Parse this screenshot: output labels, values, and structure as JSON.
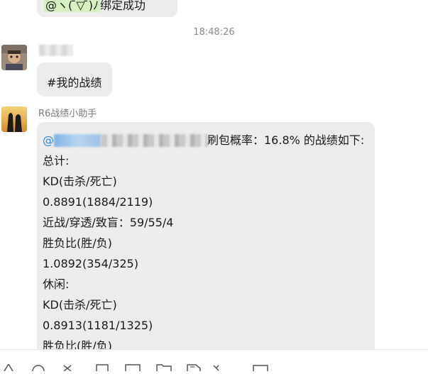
{
  "messages": {
    "top_partial": {
      "mention_prefix": "@ヽ( ̄▽ ̄)ﾉ",
      "text": "绑定成功"
    },
    "timestamp": "18:48:26",
    "user_message": {
      "text": "#我的战绩"
    },
    "bot_message": {
      "sender_name": "R6战绩小助手",
      "mention_at": "@",
      "lines": [
        "刷包概率：16.8% 的战绩如下:",
        "总计:",
        "KD(击杀/死亡)",
        "0.8891(1884/2119)",
        "近战/穿透/致盲：59/55/4",
        "胜负比(胜/负)",
        "1.0892(354/325)",
        "休闲:",
        "KD(击杀/死亡)",
        "0.8913(1181/1325)",
        "胜负比(胜/负)"
      ]
    }
  },
  "toolbar": {
    "icons": [
      "font-icon",
      "emoji-icon",
      "scissors-icon",
      "screenshot-icon",
      "image-icon",
      "folder-icon",
      "file-icon",
      "document-icon",
      "voice-icon",
      "more-icon"
    ]
  },
  "colors": {
    "bubble_bg": "#ececec",
    "mention_blue": "#2b8ae2",
    "timestamp_gray": "#8a8a8a"
  }
}
